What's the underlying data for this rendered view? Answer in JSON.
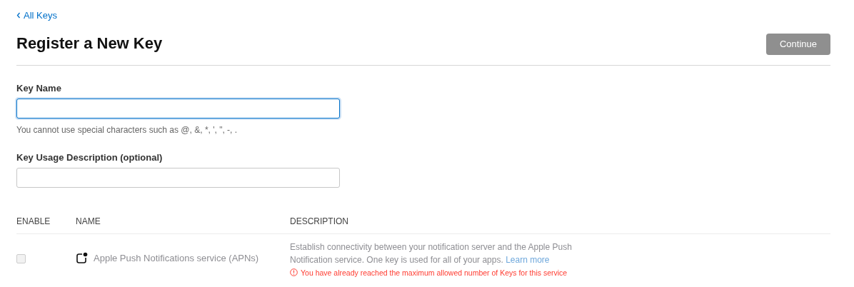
{
  "back_link": {
    "label": "All Keys"
  },
  "title": "Register a New Key",
  "continue_button": {
    "label": "Continue",
    "disabled": true
  },
  "fields": [
    {
      "label": "Key Name",
      "focused": true,
      "hint": "You cannot use special characters such as @, &, *, ', \", -, ."
    },
    {
      "label": "Key Usage Description (optional)",
      "focused": false
    }
  ],
  "table": {
    "columns": [
      "ENABLE",
      "NAME",
      "DESCRIPTION"
    ],
    "rows": [
      {
        "checked": false,
        "disabled": true,
        "name": "Apple Push Notifications service (APNs)",
        "description": "Establish connectivity between your notification server and the Apple Push Notification service. One key is used for all of your apps.",
        "link": "Learn more",
        "error": "You have already reached the maximum allowed number of Keys for this service"
      }
    ]
  }
}
